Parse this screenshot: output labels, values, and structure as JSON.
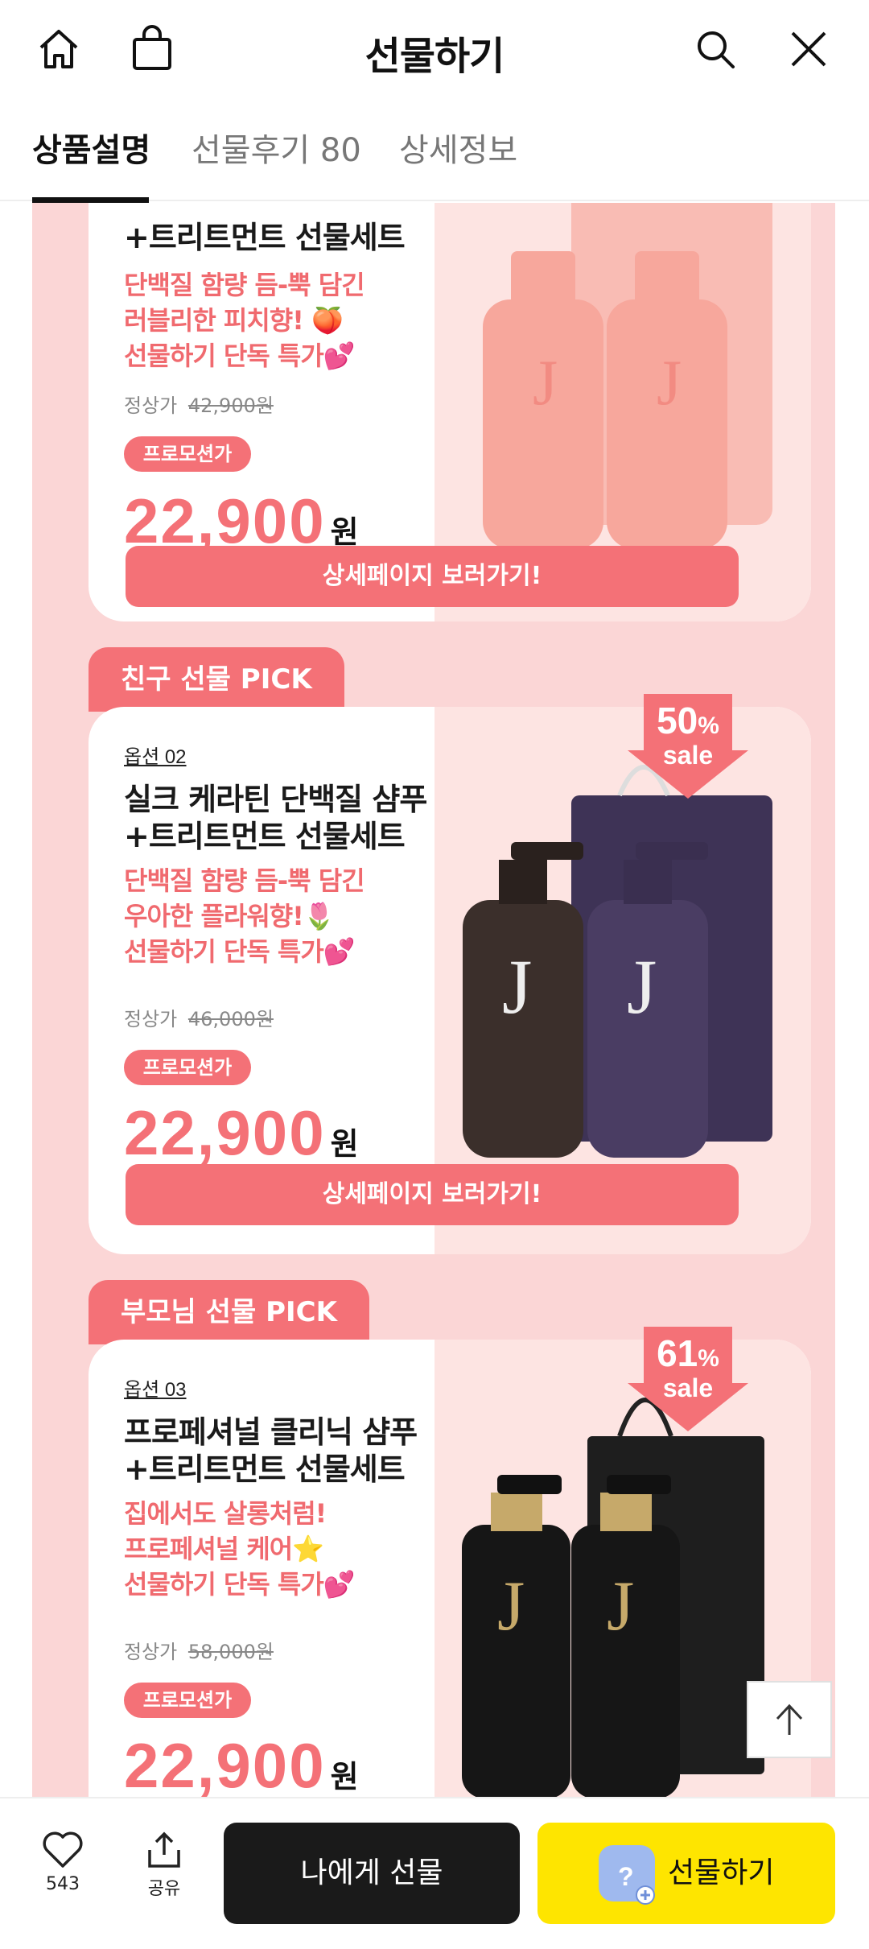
{
  "header": {
    "title": "선물하기",
    "home_icon": "home-icon",
    "bag_icon": "shopping-bag-icon",
    "search_icon": "search-icon",
    "close_icon": "close-icon"
  },
  "tabs": [
    {
      "label": "상품설명",
      "active": true
    },
    {
      "label": "선물후기 80",
      "active": false
    },
    {
      "label": "상세정보",
      "active": false
    }
  ],
  "product_partial": {
    "name_tail": "+트리트먼트 선물세트",
    "desc": [
      "단백질 함량 듬-뿍 담긴",
      "러블리한 피치향! 🍑",
      "선물하기 단독 특가💕"
    ],
    "regular_label": "정상가",
    "regular_price": "42,900원",
    "promo_label": "프로모션가",
    "price": "22,900",
    "won": "원",
    "detail_button": "상세페이지 보러가기!"
  },
  "product_friend": {
    "tag": "친구 선물 PICK",
    "option": "옵션 02",
    "name": [
      "실크 케라틴 단백질 샴푸",
      "+트리트먼트 선물세트"
    ],
    "desc": [
      "단백질 함량 듬-뿍 담긴",
      "우아한 플라워향!🌷",
      "선물하기 단독 특가💕"
    ],
    "regular_label": "정상가",
    "regular_price": "46,000원",
    "promo_label": "프로모션가",
    "price": "22,900",
    "won": "원",
    "sale_pct": "50",
    "sale_pct_unit": "%",
    "sale_word": "sale",
    "detail_button": "상세페이지 보러가기!"
  },
  "product_parents": {
    "tag": "부모님 선물 PICK",
    "option": "옵션 03",
    "name": [
      "프로페셔널 클리닉 샴푸",
      "+트리트먼트 선물세트"
    ],
    "desc": [
      "집에서도 살롱처럼!",
      "프로페셔널 케어⭐",
      "선물하기 단독 특가💕"
    ],
    "regular_label": "정상가",
    "regular_price": "58,000원",
    "promo_label": "프로모션가",
    "price": "22,900",
    "won": "원",
    "sale_pct": "61",
    "sale_pct_unit": "%",
    "sale_word": "sale"
  },
  "bottom_bar": {
    "like_count": "543",
    "share_label": "공유",
    "gift_me": "나에게 선물",
    "gift": "선물하기"
  },
  "colors": {
    "accent": "#f47177",
    "panel_bg": "#fbd6d6",
    "gift_button": "#fee500",
    "dark_button": "#1a1a1a"
  }
}
